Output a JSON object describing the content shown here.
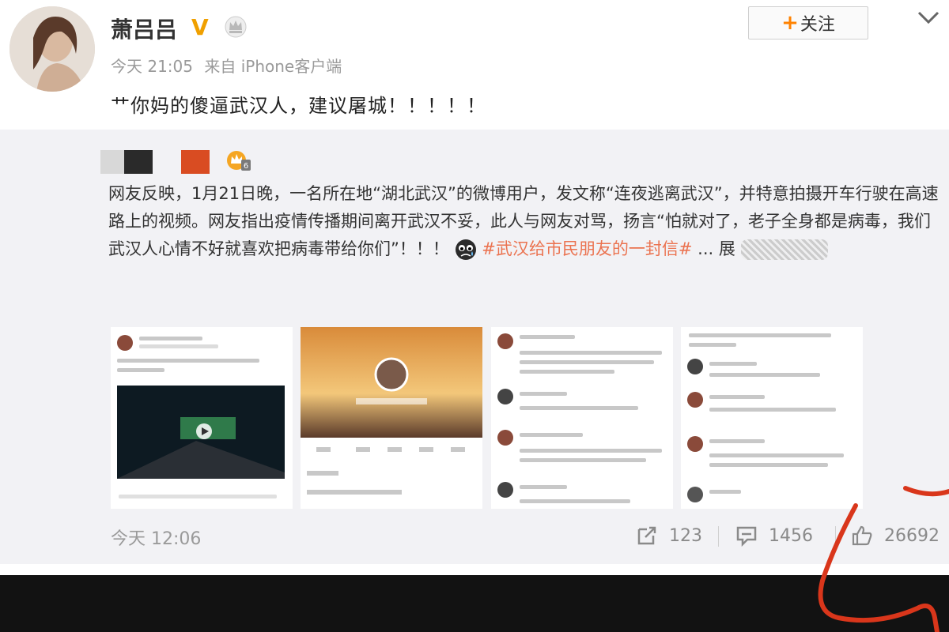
{
  "post": {
    "username": "萧吕吕",
    "verified_badge": "V",
    "timestamp": "今天 21:05",
    "source": "来自 iPhone客户端",
    "follow_label": "关注",
    "content": "艹你妈的傻逼武汉人，建议屠城！！！！！"
  },
  "repost": {
    "text_main": "网友反映，1月21日晚，一名所在地“湖北武汉”的微博用户，发文称“连夜逃离武汉”，并特意拍摄开车行驶在高速路上的视频。网友指出疫情传播期间离开武汉不妥，此人与网友对骂，扬言“怕就对了，老子全身都是病毒，我们武汉人心情不好就喜欢把病毒带给你们”！！！",
    "hashtag": "#武汉给市民朋友的一封信#",
    "ellipsis": "... 展",
    "timestamp": "今天 12:06",
    "reposts": "123",
    "comments": "1456",
    "likes": "26692"
  },
  "icons": {
    "verified": "verified-v-icon",
    "crown": "crown-icon",
    "chevron": "chevron-down-icon",
    "repost": "repost-icon",
    "comment": "comment-icon",
    "like": "thumbs-up-icon",
    "emoji": "sad-emoji-icon"
  },
  "colors": {
    "accent": "#ff8200",
    "hashtag": "#eb7350",
    "repost_bg": "#f2f2f5",
    "bottom_bar": "#121212",
    "annotation": "#d9361b"
  }
}
